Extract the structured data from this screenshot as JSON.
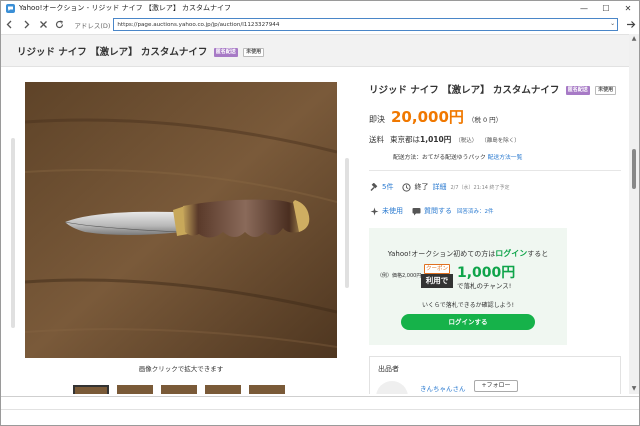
{
  "window": {
    "title": "Yahoo!オークション - リジッド ナイフ 【激レア】 カスタムナイフ",
    "minimize": "—",
    "maximize": "☐",
    "close": "✕"
  },
  "toolbar": {
    "address_label": "アドレス(D)",
    "url": "https://page.auctions.yahoo.co.jp/jp/auction/l1123327944"
  },
  "header": {
    "title": "リジッド ナイフ 【激レア】 カスタムナイフ",
    "badge_anonymous": "匿名配送",
    "badge_condition": "未使用"
  },
  "gallery": {
    "caption": "画像クリックで拡大できます",
    "thumbnail_count": 5
  },
  "item": {
    "title": "リジッド ナイフ 【激レア】 カスタムナイフ",
    "badge_anonymous": "匿名配送",
    "badge_condition": "未使用",
    "price_label": "即決",
    "price": "20,000円",
    "tax": "（税 0 円）",
    "shipping_label": "送料",
    "shipping_region": "東京都は",
    "shipping_fee": "1,010円",
    "shipping_tax": "（税込）",
    "shipping_note": "（離島を除く）",
    "method_prefix": "配送方法：おてがる配送ゆうパック",
    "method_link": "配送方法一覧",
    "watch_count": "5件",
    "status": "終了",
    "detail_link": "詳細",
    "end_time": "2/7（水）21:14 終了予定",
    "condition": "未使用",
    "question_link": "質問する",
    "answered": "回答済み：2件"
  },
  "promo": {
    "line1_prefix": "Yahoo!オークション初めての方は",
    "line1_highlight": "ログイン",
    "line1_suffix": "すると",
    "balance": "（例）価格2,000円",
    "coupon_tag": "クーポン",
    "coupon_label": "利用で",
    "amount": "1,000円",
    "desc": "で落札のチャンス!",
    "line3": "いくらで落札できるか確認しよう!",
    "button": "ログインする"
  },
  "seller": {
    "title": "出品者",
    "name": "きんちゃんさん",
    "follow": "+フォロー"
  },
  "colors": {
    "price": "#f07800",
    "accent_green": "#16b24a",
    "link": "#2a7ad0",
    "badge_purple": "#a77ac6"
  }
}
